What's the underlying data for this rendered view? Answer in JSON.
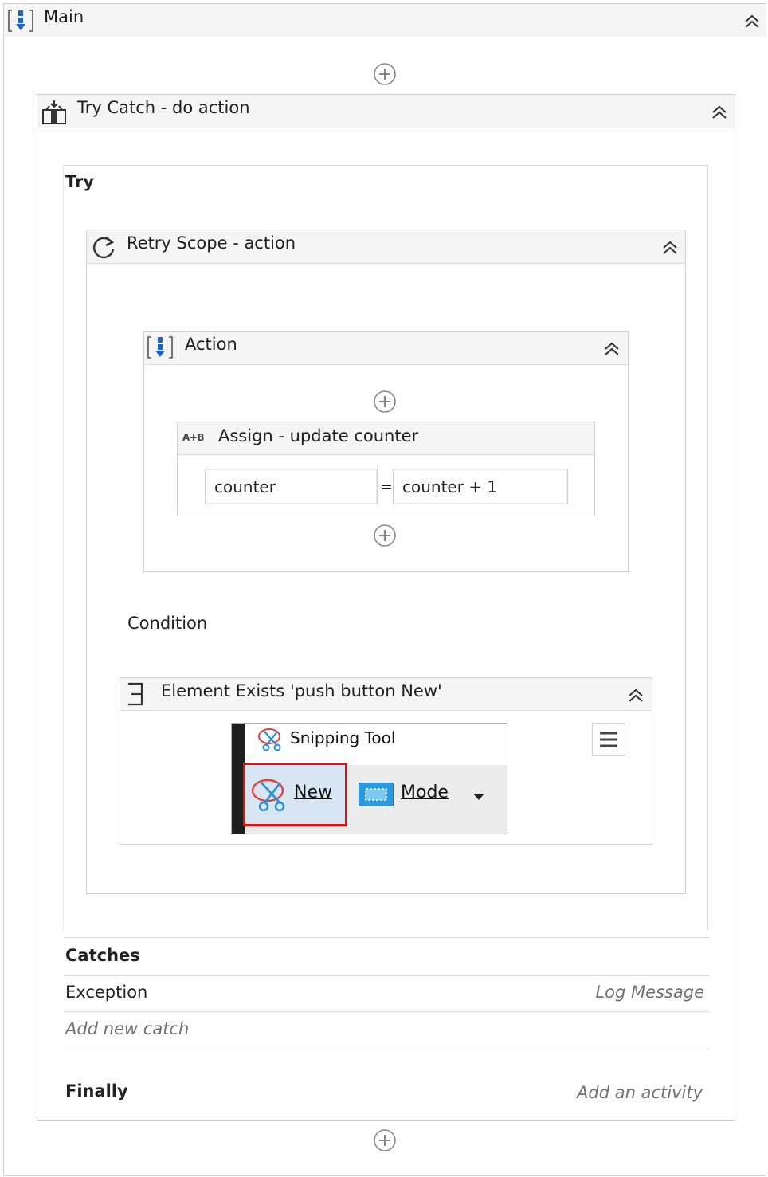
{
  "main": {
    "title": "Main",
    "icon": "sequence-icon"
  },
  "try_catch": {
    "title": "Try Catch - do action",
    "icon": "try-catch-icon",
    "try_label": "Try",
    "catches_label": "Catches",
    "exception": {
      "type": "Exception",
      "handler": "Log Message"
    },
    "add_catch": "Add new catch",
    "finally_label": "Finally",
    "finally_placeholder": "Add an activity"
  },
  "retry_scope": {
    "title": "Retry Scope - action",
    "icon": "retry-icon",
    "condition_label": "Condition"
  },
  "action_sequence": {
    "title": "Action",
    "icon": "sequence-icon"
  },
  "assign": {
    "title": "Assign - update counter",
    "icon": "assign-icon",
    "icon_text": "A+B",
    "to": "counter",
    "operator": "=",
    "value": "counter + 1"
  },
  "element_exists": {
    "title": "Element Exists 'push button  New'",
    "icon": "element-exists-icon",
    "preview": {
      "app_title": "Snipping Tool",
      "new_button": "New",
      "mode_button": "Mode",
      "highlight_color": "#e01010"
    }
  },
  "colors": {
    "accent_blue": "#1c63c4",
    "header_bg": "#f5f5f5",
    "border": "#cfcfcf"
  }
}
